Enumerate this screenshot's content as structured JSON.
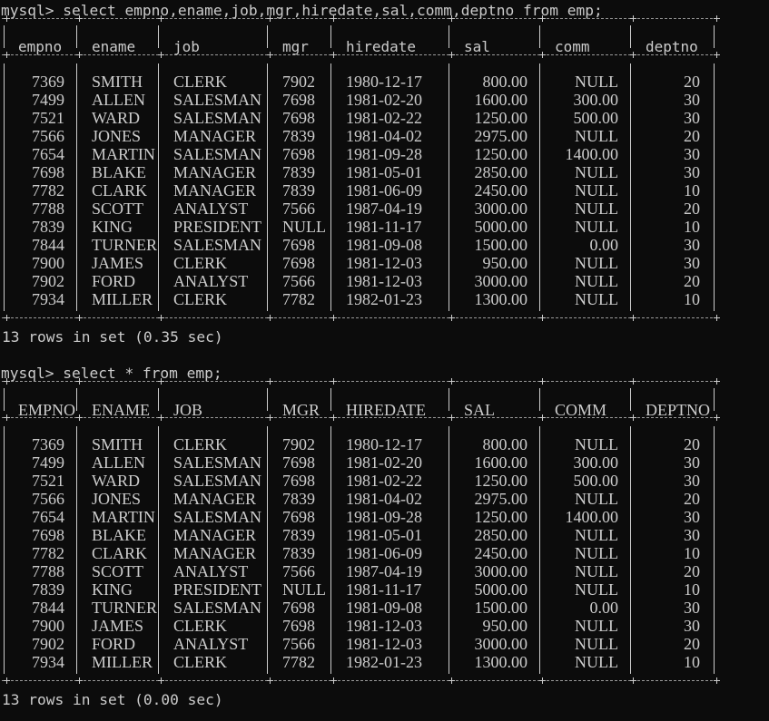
{
  "session": {
    "query1": "mysql> select empno,ename,job,mgr,hiredate,sal,comm,deptno from emp;",
    "result1": "13 rows in set (0.35 sec)",
    "query2": "mysql> select * from emp;",
    "result2": "13 rows in set (0.00 sec)"
  },
  "table1": {
    "headers": [
      "empno",
      "ename",
      "job",
      "mgr",
      "hiredate",
      "sal",
      "comm",
      "deptno"
    ],
    "rows": [
      [
        "7369",
        "SMITH",
        "CLERK",
        "7902",
        "1980-12-17",
        "800.00",
        "NULL",
        "20"
      ],
      [
        "7499",
        "ALLEN",
        "SALESMAN",
        "7698",
        "1981-02-20",
        "1600.00",
        "300.00",
        "30"
      ],
      [
        "7521",
        "WARD",
        "SALESMAN",
        "7698",
        "1981-02-22",
        "1250.00",
        "500.00",
        "30"
      ],
      [
        "7566",
        "JONES",
        "MANAGER",
        "7839",
        "1981-04-02",
        "2975.00",
        "NULL",
        "20"
      ],
      [
        "7654",
        "MARTIN",
        "SALESMAN",
        "7698",
        "1981-09-28",
        "1250.00",
        "1400.00",
        "30"
      ],
      [
        "7698",
        "BLAKE",
        "MANAGER",
        "7839",
        "1981-05-01",
        "2850.00",
        "NULL",
        "30"
      ],
      [
        "7782",
        "CLARK",
        "MANAGER",
        "7839",
        "1981-06-09",
        "2450.00",
        "NULL",
        "10"
      ],
      [
        "7788",
        "SCOTT",
        "ANALYST",
        "7566",
        "1987-04-19",
        "3000.00",
        "NULL",
        "20"
      ],
      [
        "7839",
        "KING",
        "PRESIDENT",
        "NULL",
        "1981-11-17",
        "5000.00",
        "NULL",
        "10"
      ],
      [
        "7844",
        "TURNER",
        "SALESMAN",
        "7698",
        "1981-09-08",
        "1500.00",
        "0.00",
        "30"
      ],
      [
        "7900",
        "JAMES",
        "CLERK",
        "7698",
        "1981-12-03",
        "950.00",
        "NULL",
        "30"
      ],
      [
        "7902",
        "FORD",
        "ANALYST",
        "7566",
        "1981-12-03",
        "3000.00",
        "NULL",
        "20"
      ],
      [
        "7934",
        "MILLER",
        "CLERK",
        "7782",
        "1982-01-23",
        "1300.00",
        "NULL",
        "10"
      ]
    ]
  },
  "table2": {
    "headers": [
      "EMPNO",
      "ENAME",
      "JOB",
      "MGR",
      "HIREDATE",
      "SAL",
      "COMM",
      "DEPTNO"
    ],
    "rows": [
      [
        "7369",
        "SMITH",
        "CLERK",
        "7902",
        "1980-12-17",
        "800.00",
        "NULL",
        "20"
      ],
      [
        "7499",
        "ALLEN",
        "SALESMAN",
        "7698",
        "1981-02-20",
        "1600.00",
        "300.00",
        "30"
      ],
      [
        "7521",
        "WARD",
        "SALESMAN",
        "7698",
        "1981-02-22",
        "1250.00",
        "500.00",
        "30"
      ],
      [
        "7566",
        "JONES",
        "MANAGER",
        "7839",
        "1981-04-02",
        "2975.00",
        "NULL",
        "20"
      ],
      [
        "7654",
        "MARTIN",
        "SALESMAN",
        "7698",
        "1981-09-28",
        "1250.00",
        "1400.00",
        "30"
      ],
      [
        "7698",
        "BLAKE",
        "MANAGER",
        "7839",
        "1981-05-01",
        "2850.00",
        "NULL",
        "30"
      ],
      [
        "7782",
        "CLARK",
        "MANAGER",
        "7839",
        "1981-06-09",
        "2450.00",
        "NULL",
        "10"
      ],
      [
        "7788",
        "SCOTT",
        "ANALYST",
        "7566",
        "1987-04-19",
        "3000.00",
        "NULL",
        "20"
      ],
      [
        "7839",
        "KING",
        "PRESIDENT",
        "NULL",
        "1981-11-17",
        "5000.00",
        "NULL",
        "10"
      ],
      [
        "7844",
        "TURNER",
        "SALESMAN",
        "7698",
        "1981-09-08",
        "1500.00",
        "0.00",
        "30"
      ],
      [
        "7900",
        "JAMES",
        "CLERK",
        "7698",
        "1981-12-03",
        "950.00",
        "NULL",
        "30"
      ],
      [
        "7902",
        "FORD",
        "ANALYST",
        "7566",
        "1981-12-03",
        "3000.00",
        "NULL",
        "20"
      ],
      [
        "7934",
        "MILLER",
        "CLERK",
        "7782",
        "1982-01-23",
        "1300.00",
        "NULL",
        "10"
      ]
    ]
  }
}
